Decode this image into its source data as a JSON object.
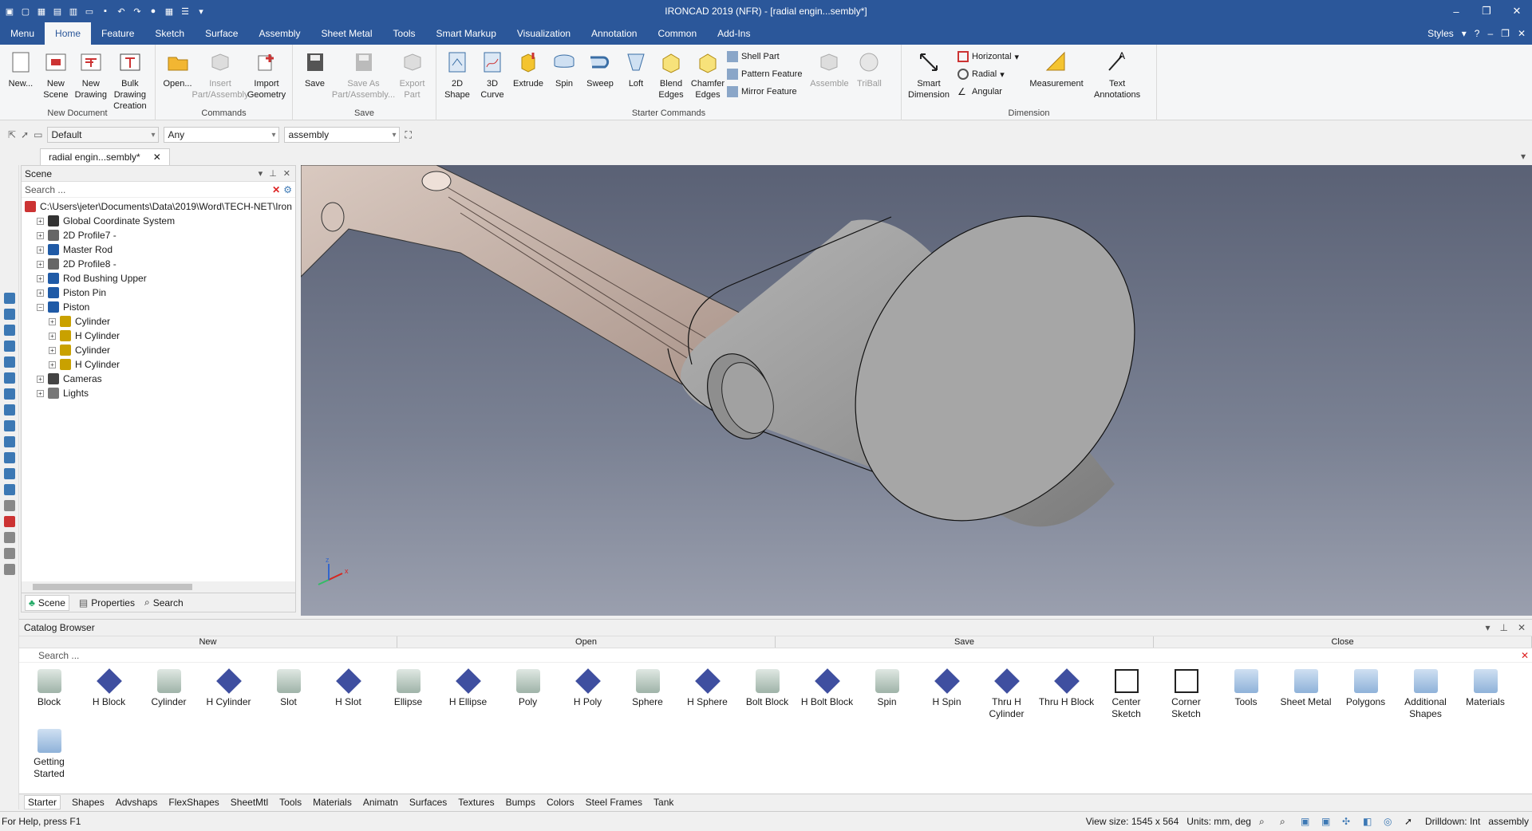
{
  "window": {
    "title": "IRONCAD 2019 (NFR) - [radial engin...sembly*]"
  },
  "menu": {
    "tabs": [
      "Menu",
      "Home",
      "Feature",
      "Sketch",
      "Surface",
      "Assembly",
      "Sheet Metal",
      "Tools",
      "Smart Markup",
      "Visualization",
      "Annotation",
      "Common",
      "Add-Ins"
    ],
    "active": "Home",
    "styles_label": "Styles"
  },
  "ribbon": {
    "new_document": {
      "label": "New Document",
      "buttons": [
        "New...",
        "New\nScene",
        "New\nDrawing",
        "Bulk Drawing\nCreation"
      ]
    },
    "commands": {
      "label": "Commands",
      "buttons": [
        "Open...",
        "Insert\nPart/Assembly",
        "Import\nGeometry"
      ]
    },
    "save": {
      "label": "Save",
      "buttons": [
        "Save",
        "Save As\nPart/Assembly...",
        "Export\nPart"
      ]
    },
    "starter": {
      "label": "Starter Commands",
      "buttons": [
        "2D\nShape",
        "3D\nCurve",
        "Extrude",
        "Spin",
        "Sweep",
        "Loft",
        "Blend\nEdges",
        "Chamfer\nEdges"
      ],
      "small": [
        "Shell Part",
        "Pattern Feature",
        "Mirror Feature"
      ],
      "disabled": [
        "Assemble",
        "TriBall"
      ]
    },
    "dimension": {
      "label": "Dimension",
      "small": [
        "Horizontal",
        "Radial",
        "Angular"
      ],
      "buttons": [
        "Smart\nDimension",
        "Measurement",
        "Text\nAnnotations"
      ]
    }
  },
  "toolbar2": {
    "style": "Default",
    "filter": "Any",
    "level": "assembly"
  },
  "document_tab": "radial engin...sembly*",
  "scene_panel": {
    "title": "Scene",
    "search_placeholder": "Search ...",
    "tree": [
      {
        "label": "C:\\Users\\jeter\\Documents\\Data\\2019\\Word\\TECH-NET\\Iron",
        "level": 0,
        "icon": "assembly-root-icon"
      },
      {
        "label": "Global Coordinate System",
        "level": 1,
        "icon": "coordinate-system-icon"
      },
      {
        "label": "2D Profile7 -",
        "level": 1,
        "icon": "profile-icon"
      },
      {
        "label": "Master Rod",
        "level": 1,
        "icon": "part-icon"
      },
      {
        "label": "2D Profile8 -",
        "level": 1,
        "icon": "profile-icon"
      },
      {
        "label": "Rod Bushing Upper",
        "level": 1,
        "icon": "part-icon"
      },
      {
        "label": "Piston Pin",
        "level": 1,
        "icon": "part-icon"
      },
      {
        "label": "Piston",
        "level": 1,
        "icon": "part-icon",
        "expanded": true
      },
      {
        "label": "Cylinder",
        "level": 2,
        "icon": "feature-icon"
      },
      {
        "label": "H Cylinder",
        "level": 2,
        "icon": "feature-icon"
      },
      {
        "label": "Cylinder",
        "level": 2,
        "icon": "feature-icon"
      },
      {
        "label": "H Cylinder",
        "level": 2,
        "icon": "feature-icon"
      },
      {
        "label": "Cameras",
        "level": 1,
        "icon": "camera-icon"
      },
      {
        "label": "Lights",
        "level": 1,
        "icon": "light-icon"
      }
    ],
    "tabs": [
      "Scene",
      "Properties",
      "Search"
    ]
  },
  "catalog": {
    "title": "Catalog Browser",
    "actions": [
      "New",
      "Open",
      "Save",
      "Close"
    ],
    "search_placeholder": "Search ...",
    "items": [
      "Block",
      "H Block",
      "Cylinder",
      "H Cylinder",
      "Slot",
      "H Slot",
      "Ellipse",
      "H Ellipse",
      "Poly",
      "H Poly",
      "Sphere",
      "H Sphere",
      "Bolt Block",
      "H Bolt Block",
      "Spin",
      "H Spin",
      "Thru H\nCylinder",
      "Thru H Block",
      "Center\nSketch",
      "Corner\nSketch",
      "Tools",
      "Sheet Metal",
      "Polygons",
      "Additional\nShapes",
      "Materials",
      "Getting\nStarted"
    ],
    "tabs": [
      "Starter",
      "Shapes",
      "Advshaps",
      "FlexShapes",
      "SheetMtl",
      "Tools",
      "Materials",
      "Animatn",
      "Surfaces",
      "Textures",
      "Bumps",
      "Colors",
      "Steel Frames",
      "Tank"
    ]
  },
  "status": {
    "help": "For Help, press F1",
    "view_size": "View size: 1545 x  564",
    "units": "Units: mm, deg",
    "drilldown": "Drilldown: Int",
    "level": "assembly"
  },
  "colors": {
    "titlebar": "#2b579a",
    "viewport_top": "#5a6175",
    "viewport_bottom": "#9a9fae",
    "piston": "#9e9e9e",
    "rod": "#c8b6ad"
  }
}
